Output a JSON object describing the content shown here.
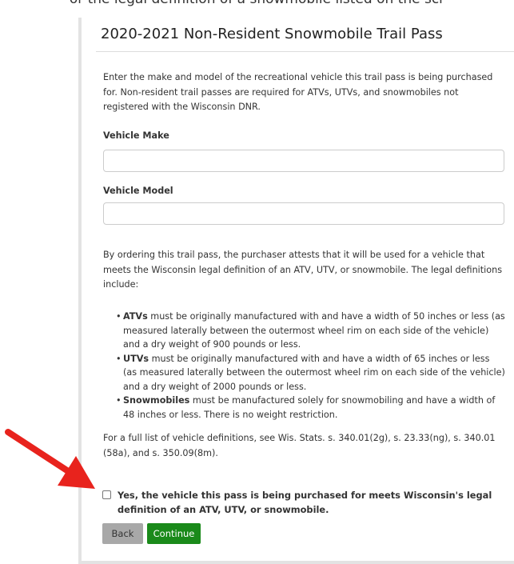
{
  "top_text": "or the legal definition of a snowmobile listed on the scr",
  "form": {
    "title": "2020-2021 Non-Resident Snowmobile Trail Pass",
    "intro": "Enter the make and model of the recreational vehicle this trail pass is being purchased for. Non-resident trail passes are required for ATVs, UTVs, and snowmobiles not registered with the Wisconsin DNR.",
    "vehicle_make": {
      "label": "Vehicle Make",
      "value": "",
      "placeholder": ""
    },
    "vehicle_model": {
      "label": "Vehicle Model",
      "value": "",
      "placeholder": ""
    },
    "attest": "By ordering this trail pass, the purchaser attests that it will be used for a vehicle that meets the Wisconsin legal definition of an ATV, UTV, or snowmobile. The legal definitions include:",
    "definitions": [
      {
        "term": "ATVs",
        "text": " must be originally manufactured with and have a width of 50 inches or less (as measured laterally between the outermost wheel rim on each side of the vehicle) and a dry weight of 900 pounds or less."
      },
      {
        "term": "UTVs",
        "text": " must be originally manufactured with and have a width of 65 inches or less (as measured laterally between the outermost wheel rim on each side of the vehicle) and a dry weight of 2000 pounds or less."
      },
      {
        "term": "Snowmobiles",
        "text": " must be manufactured solely for snowmobiling and have a width of 48 inches or less. There is no weight restriction."
      }
    ],
    "full_list": "For a full list of vehicle definitions, see Wis. Stats. s. 340.01(2g), s. 23.33(ng), s. 340.01 (58a), and s. 350.09(8m).",
    "checkbox_label": "Yes, the vehicle this pass is being purchased for meets Wisconsin's legal definition of an ATV, UTV, or snowmobile.",
    "checkbox_checked": false,
    "buttons": {
      "back": "Back",
      "continue": "Continue"
    }
  },
  "colors": {
    "arrow": "#e8231d",
    "continue_button": "#1a8a1a",
    "back_button": "#a8a8a8"
  },
  "icons": {
    "bullet": "•",
    "annotation": "red-arrow-icon"
  }
}
